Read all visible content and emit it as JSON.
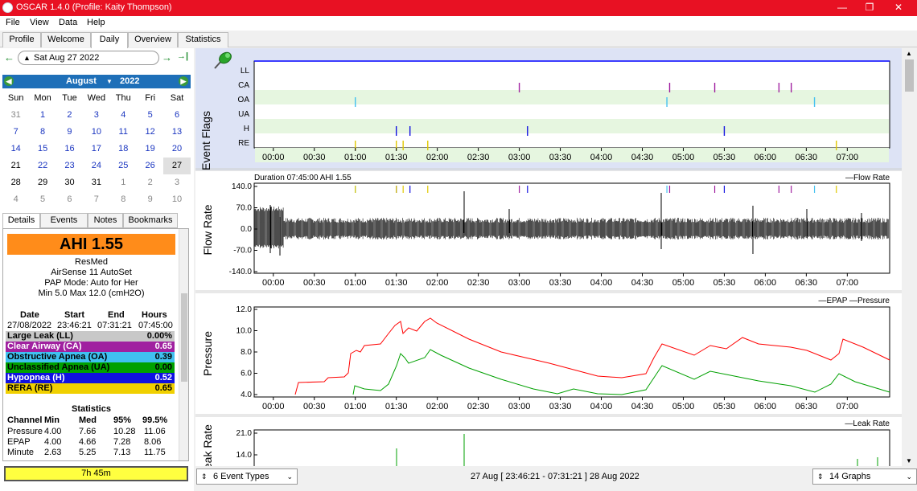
{
  "window": {
    "title": "OSCAR 1.4.0 (Profile: Kaity Thompson)",
    "minimize": "—",
    "maximize": "❐",
    "close": "✕"
  },
  "menu": [
    "File",
    "View",
    "Data",
    "Help"
  ],
  "tabs": [
    "Profile",
    "Welcome",
    "Daily",
    "Overview",
    "Statistics"
  ],
  "nav": {
    "back": "←",
    "date": "Sat Aug 27 2022",
    "forward": "→",
    "last": "→|"
  },
  "calendar": {
    "month": "August",
    "year": "2022",
    "weekdays": [
      "Sun",
      "Mon",
      "Tue",
      "Wed",
      "Thu",
      "Fri",
      "Sat"
    ],
    "weeks": [
      [
        "31",
        "1",
        "2",
        "3",
        "4",
        "5",
        "6"
      ],
      [
        "7",
        "8",
        "9",
        "10",
        "11",
        "12",
        "13"
      ],
      [
        "14",
        "15",
        "16",
        "17",
        "18",
        "19",
        "20"
      ],
      [
        "21",
        "22",
        "23",
        "24",
        "25",
        "26",
        "27"
      ],
      [
        "28",
        "29",
        "30",
        "31",
        "1",
        "2",
        "3"
      ],
      [
        "4",
        "5",
        "6",
        "7",
        "8",
        "9",
        "10"
      ]
    ]
  },
  "subtabs": [
    "Details",
    "Events",
    "Notes",
    "Bookmarks"
  ],
  "details": {
    "ahi": "AHI 1.55",
    "manufacturer": "ResMed",
    "model": "AirSense 11 AutoSet",
    "mode": "PAP Mode: Auto for Her",
    "pressure_range": "Min 5.0 Max 12.0 (cmH2O)",
    "session_headers": [
      "Date",
      "Start",
      "End",
      "Hours"
    ],
    "session": [
      "27/08/2022",
      "23:46:21",
      "07:31:21",
      "07:45:00"
    ],
    "events": [
      {
        "name": "Large Leak (LL)",
        "value": "0.00%",
        "color": "#c8c8c8",
        "text": "#000000"
      },
      {
        "name": "Clear Airway (CA)",
        "value": "0.65",
        "color": "#a020a0",
        "text": "#ffffff"
      },
      {
        "name": "Obstructive Apnea (OA)",
        "value": "0.39",
        "color": "#40c0f0",
        "text": "#000000"
      },
      {
        "name": "Unclassified Apnea (UA)",
        "value": "0.00",
        "color": "#00a000",
        "text": "#000000"
      },
      {
        "name": "Hypopnea (H)",
        "value": "0.52",
        "color": "#1010e0",
        "text": "#ffffff"
      },
      {
        "name": "RERA (RE)",
        "value": "0.65",
        "color": "#f0d000",
        "text": "#000000"
      }
    ],
    "stats_title": "Statistics",
    "stats_headers": [
      "Channel",
      "Min",
      "Med",
      "95%",
      "99.5%"
    ],
    "stats": [
      [
        "Pressure",
        "4.00",
        "7.66",
        "10.28",
        "11.06"
      ],
      [
        "EPAP",
        "4.00",
        "4.66",
        "7.28",
        "8.06"
      ],
      [
        "Minute",
        "2.63",
        "5.25",
        "7.13",
        "11.75"
      ]
    ]
  },
  "total_time": "7h 45m",
  "time_ticks": [
    "00:00",
    "00:30",
    "01:00",
    "01:30",
    "02:00",
    "02:30",
    "03:00",
    "03:30",
    "04:00",
    "04:30",
    "05:00",
    "05:30",
    "06:00",
    "06:30",
    "07:00"
  ],
  "event_flags": {
    "label": "Event Flags",
    "rows": [
      "LL",
      "CA",
      "OA",
      "UA",
      "H",
      "RE"
    ],
    "colors": {
      "CA": "#a020a0",
      "OA": "#40c0f0",
      "H": "#1010e0",
      "RE": "#e0c800"
    },
    "events": {
      "CA": [
        "03:00",
        "04:50",
        "05:23",
        "06:10",
        "06:19"
      ],
      "OA": [
        "01:00",
        "04:48",
        "06:36"
      ],
      "H": [
        "01:30",
        "01:40",
        "03:06",
        "05:30"
      ],
      "RE": [
        "01:00",
        "01:30",
        "01:35",
        "01:53",
        "06:52"
      ]
    }
  },
  "flow_rate": {
    "label": "Flow Rate",
    "legend": "Flow Rate",
    "info": "Duration 07:45:00 AHI 1.55",
    "yticks": [
      "140.0",
      "70.0",
      "0.0",
      "-70.0",
      "-140.0"
    ]
  },
  "pressure": {
    "label": "Pressure",
    "legend_epap": "EPAP",
    "legend_pressure": "Pressure",
    "yticks": [
      "12.0",
      "10.0",
      "8.0",
      "6.0",
      "4.0"
    ],
    "epap_color": "#00a000",
    "pressure_color": "#ff0000"
  },
  "leak_rate": {
    "label": "Leak Rate",
    "legend": "Leak Rate",
    "yticks": [
      "21.0",
      "14.0"
    ]
  },
  "bottom": {
    "event_types": "6 Event Types",
    "range": "27 Aug [ 23:46:21 - 07:31:21 ] 28 Aug 2022",
    "graphs": "14 Graphs"
  }
}
